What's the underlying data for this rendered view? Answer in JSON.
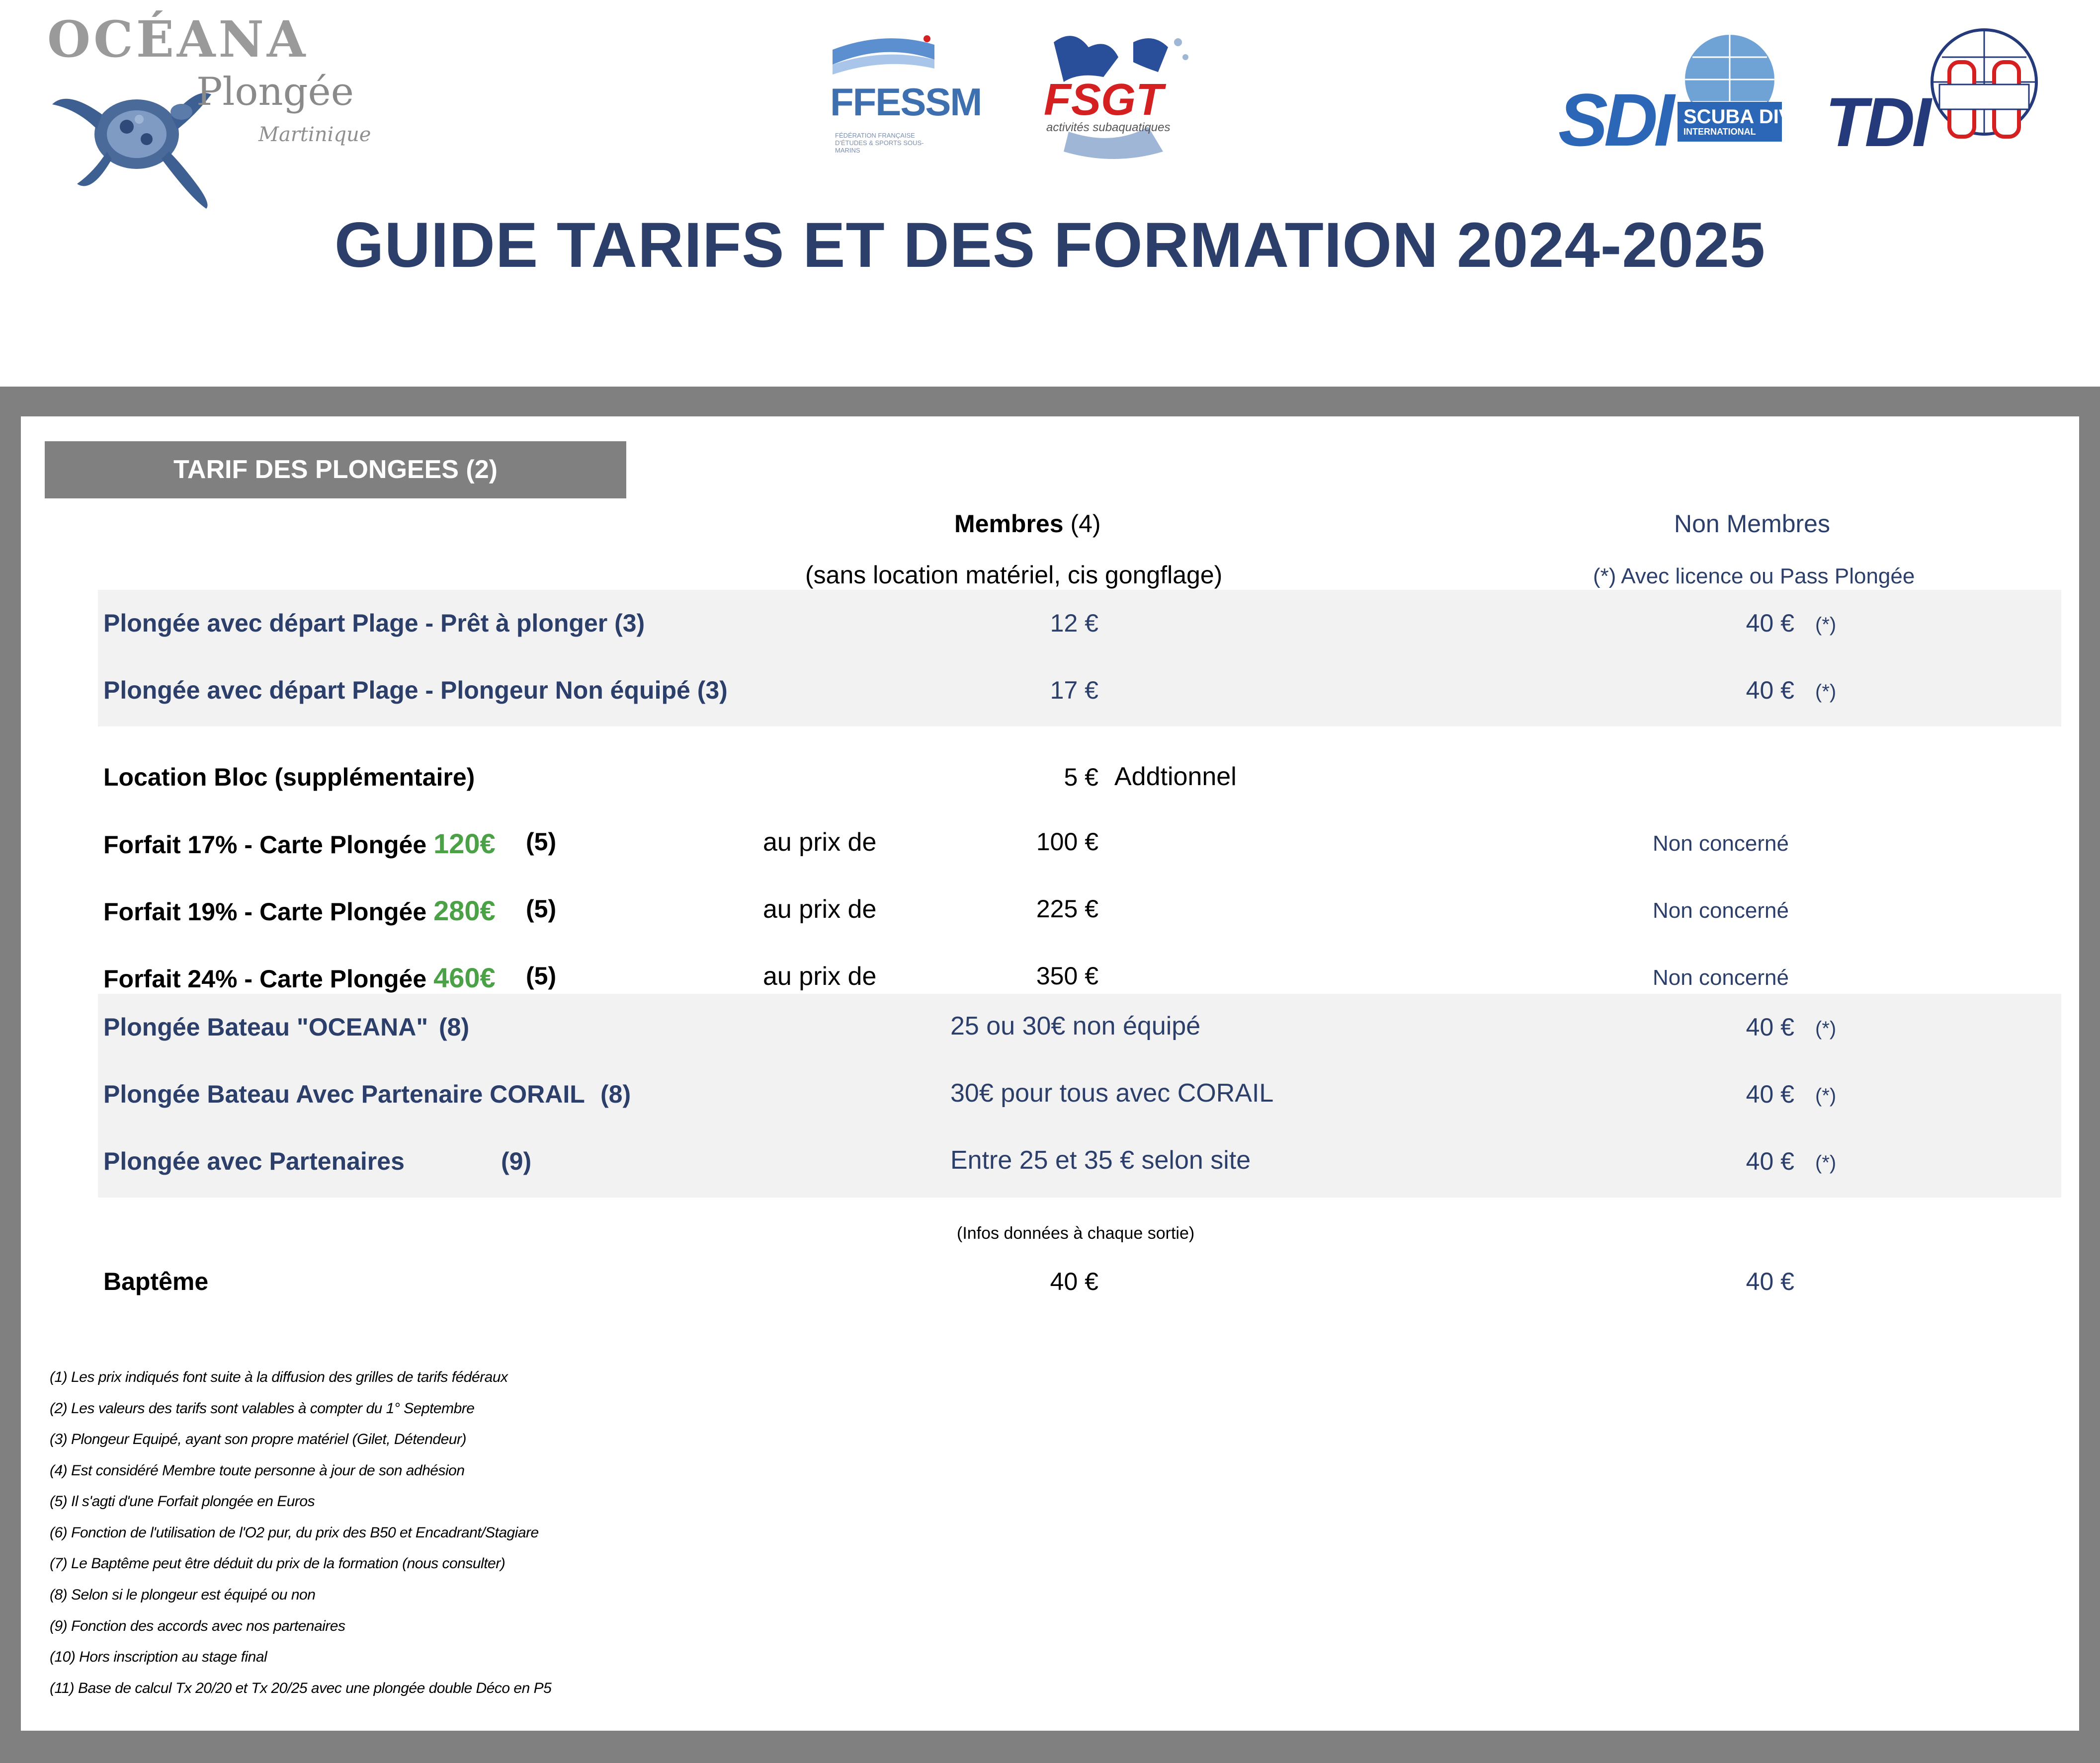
{
  "header": {
    "logos": {
      "oceana": {
        "word": "OCÉANA",
        "plongee": "Plongée",
        "sub": "Martinique"
      },
      "ffessm": {
        "word": "FFESSM",
        "small": "FÉDÉRATION FRANÇAISE D'ÉTUDES & SPORTS SOUS-MARINS"
      },
      "fsgt": {
        "word": "FSGT",
        "sub": "activités subaquatiques"
      },
      "sdi": {
        "word": "SDI",
        "text": "SCUBA DIVING",
        "text2": "INTERNATIONAL"
      },
      "tdi": {
        "word": "TDI"
      }
    },
    "title": "GUIDE TARIFS ET DES FORMATION 2024-2025"
  },
  "section": {
    "tab": "TARIF DES PLONGEES (2)",
    "members_header": "Membres",
    "members_ref": "(4)",
    "members_sub": "(sans location matériel, cis gongflage)",
    "nonmembers_header": "Non Membres",
    "nonmembers_sub": "(*) Avec licence ou Pass Plongée"
  },
  "rows": {
    "plage_pret": {
      "label": "Plongée avec départ Plage -  Prêt à plonger (3)",
      "member": "12 €",
      "nonmember": "40 €",
      "star": "(*)"
    },
    "plage_non_equipe": {
      "label": "Plongée avec départ Plage - Plongeur Non équipé (3)",
      "member": "17 €",
      "nonmember": "40 €",
      "star": "(*)"
    },
    "location_bloc": {
      "label": "Location Bloc (supplémentaire)",
      "member": "5 €",
      "extra": "Addtionnel"
    },
    "forfait17": {
      "label": "Forfait 17% - Carte Plongée",
      "amount": "120€",
      "ref": "(5)",
      "au_prix": "au prix de",
      "member": "100 €",
      "nonmember": "Non concerné"
    },
    "forfait19": {
      "label": "Forfait 19% - Carte Plongée",
      "amount": "280€",
      "ref": "(5)",
      "au_prix": "au prix de",
      "member": "225 €",
      "nonmember": "Non concerné"
    },
    "forfait24": {
      "label": "Forfait 24% - Carte Plongée",
      "amount": "460€",
      "ref": "(5)",
      "au_prix": "au prix de",
      "member": "350 €",
      "nonmember": "Non concerné"
    },
    "bateau_oceana": {
      "label": "Plongée Bateau \"OCEANA\"",
      "ref": "(8)",
      "member": "25 ou 30€ non équipé",
      "nonmember": "40 €",
      "star": "(*)"
    },
    "bateau_corail": {
      "label": "Plongée Bateau Avec Partenaire CORAIL",
      "ref": "(8)",
      "member": "30€ pour tous avec CORAIL",
      "nonmember": "40 €",
      "star": "(*)"
    },
    "partenaires": {
      "label": "Plongée avec Partenaires",
      "ref": "(9)",
      "member": "Entre 25 et 35 € selon site",
      "nonmember": "40 €",
      "star": "(*)"
    },
    "infos": "(Infos données à chaque sortie)",
    "bapteme": {
      "label": "Baptême",
      "member": "40 €",
      "nonmember": "40 €"
    }
  },
  "footnotes": [
    "(1) Les prix indiqués font suite à la diffusion des grilles de tarifs fédéraux",
    "(2) Les valeurs des tarifs sont valables à compter du 1° Septembre",
    "(3) Plongeur Equipé, ayant son propre matériel (Gilet, Détendeur)",
    "(4) Est considéré Membre toute personne à jour de son adhésion",
    "(5) Il s'agti d'une Forfait plongée en Euros",
    "(6) Fonction de l'utilisation de l'O2 pur, du prix des B50 et Encadrant/Stagiare",
    "(7) Le Baptême peut être déduit du prix de la formation (nous consulter)",
    "(8) Selon si le plongeur est équipé ou non",
    "(9) Fonction des accords avec nos partenaires",
    "(10) Hors inscription au stage final",
    "(11) Base de calcul Tx 20/20 et Tx 20/25 avec une plongée double Déco en P5"
  ],
  "colors": {
    "navy": "#2c3f6b",
    "green": "#4aa146",
    "grey_frame": "#808080",
    "band": "#f2f2f2"
  }
}
